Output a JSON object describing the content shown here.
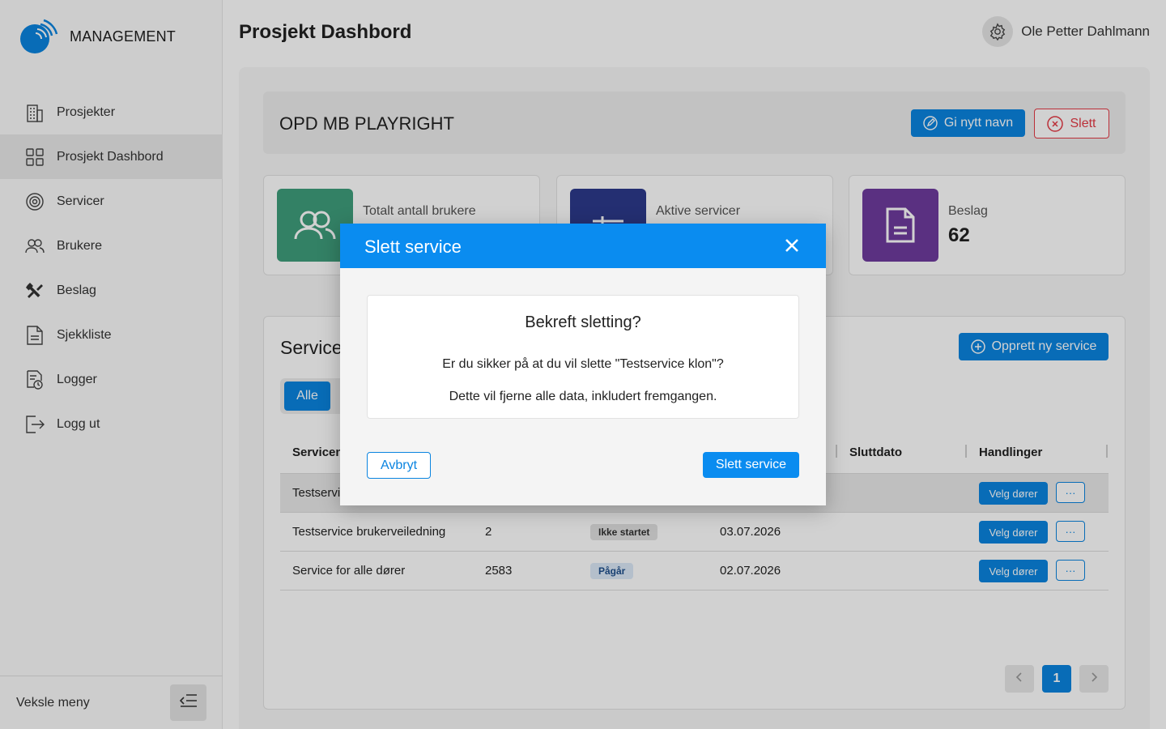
{
  "app": {
    "logo_text": "MANAGEMENT",
    "accent": "#0a84e0"
  },
  "sidebar": {
    "items": [
      {
        "label": "Prosjekter",
        "icon": "building-icon"
      },
      {
        "label": "Prosjekt Dashbord",
        "icon": "grid-icon"
      },
      {
        "label": "Servicer",
        "icon": "settings-icon"
      },
      {
        "label": "Brukere",
        "icon": "users-icon"
      },
      {
        "label": "Beslag",
        "icon": "tools-icon"
      },
      {
        "label": "Sjekkliste",
        "icon": "document-icon"
      },
      {
        "label": "Logger",
        "icon": "log-icon"
      },
      {
        "label": "Logg ut",
        "icon": "logout-icon"
      }
    ],
    "active": "Prosjekt Dashbord",
    "footer_label": "Veksle meny"
  },
  "header": {
    "title": "Prosjekt Dashbord",
    "user_name": "Ole Petter Dahlmann"
  },
  "project": {
    "name": "OPD MB PLAYRIGHT",
    "rename_label": "Gi nytt navn",
    "delete_label": "Slett"
  },
  "stats": [
    {
      "label": "Totalt antall brukere",
      "value": "",
      "color": "#3f9e7c"
    },
    {
      "label": "Aktive servicer",
      "value": "",
      "color": "#2d3a8c"
    },
    {
      "label": "Beslag",
      "value": "62",
      "color": "#6e3b9e"
    }
  ],
  "services": {
    "title": "Service",
    "new_label": "Opprett ny service",
    "filter_all": "Alle",
    "columns": {
      "name": "Servicen",
      "end": "Sluttdato",
      "actions": "Handlinger"
    },
    "rows": [
      {
        "name": "Testservic",
        "count": "",
        "status": "",
        "date": ""
      },
      {
        "name": "Testservice brukerveiledning",
        "count": "2",
        "status": "Ikke startet",
        "date": "03.07.2026"
      },
      {
        "name": "Service for alle dører",
        "count": "2583",
        "status": "Pågår",
        "date": "02.07.2026"
      }
    ],
    "velg_label": "Velg dører",
    "more_label": "···",
    "current_page": "1"
  },
  "modal": {
    "title": "Slett service",
    "confirm_title": "Bekreft sletting?",
    "question": "Er du sikker på at du vil slette \"Testservice klon\"?",
    "note": "Dette vil fjerne alle data, inkludert fremgangen.",
    "cancel_label": "Avbryt",
    "confirm_label": "Slett service"
  }
}
